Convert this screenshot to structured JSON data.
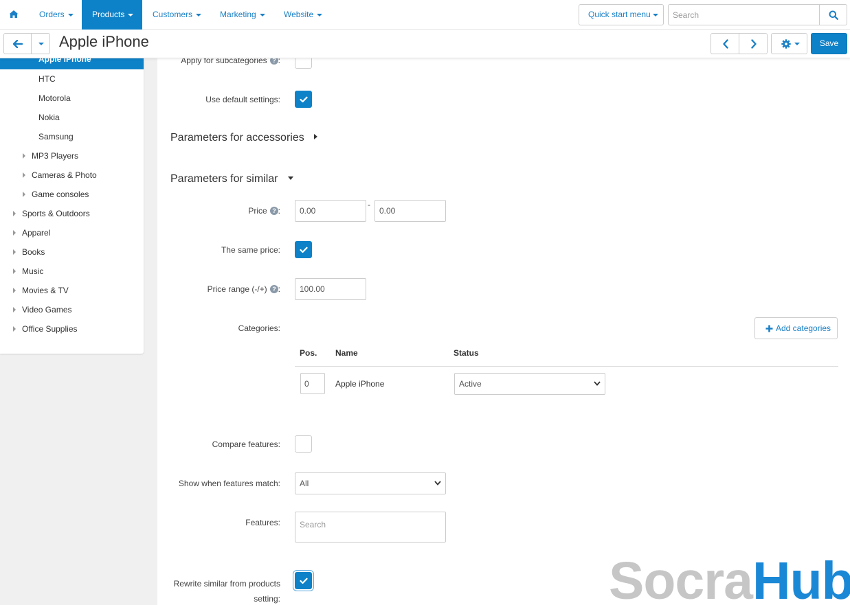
{
  "nav": {
    "items": [
      {
        "label": "Orders"
      },
      {
        "label": "Products"
      },
      {
        "label": "Customers"
      },
      {
        "label": "Marketing"
      },
      {
        "label": "Website"
      }
    ],
    "quick_start": "Quick start menu",
    "search_placeholder": "Search"
  },
  "header": {
    "title": "Apple iPhone",
    "save_label": "Save"
  },
  "sidebar": {
    "active": "Apple iPhone",
    "subitems": [
      "HTC",
      "Motorola",
      "Nokia",
      "Samsung"
    ],
    "level1": [
      "MP3 Players",
      "Cameras & Photo",
      "Game consoles"
    ],
    "level0": [
      "Sports & Outdoors",
      "Apparel",
      "Books",
      "Music",
      "Movies & TV",
      "Video Games",
      "Office Supplies"
    ]
  },
  "form": {
    "apply_subcategories": "Apply for subcategories",
    "use_default": "Use default settings:",
    "accessories_title": "Parameters for accessories",
    "similar_title": "Parameters for similar",
    "price_label": "Price",
    "price_from": "0.00",
    "price_dash": "-",
    "price_to": "0.00",
    "same_price": "The same price:",
    "price_range_label": "Price range (-/+)",
    "price_range_value": "100.00",
    "categories_label": "Categories:",
    "add_categories": "Add categories",
    "table": {
      "headers": [
        "Pos.",
        "Name",
        "Status"
      ],
      "rows": [
        {
          "pos": "0",
          "name": "Apple iPhone",
          "status": "Active"
        }
      ]
    },
    "compare_features": "Compare features:",
    "show_when_match": "Show when features match:",
    "show_when_value": "All",
    "features_label": "Features:",
    "features_placeholder": "Search",
    "rewrite_label_1": "Rewrite similar from products",
    "rewrite_label_2": "setting:"
  },
  "watermark": {
    "part1": "Socra",
    "part2": "Hub"
  },
  "colors": {
    "accent": "#0e82c8",
    "link": "#1b80c6",
    "watermark_gray": "#c6c6c6"
  }
}
